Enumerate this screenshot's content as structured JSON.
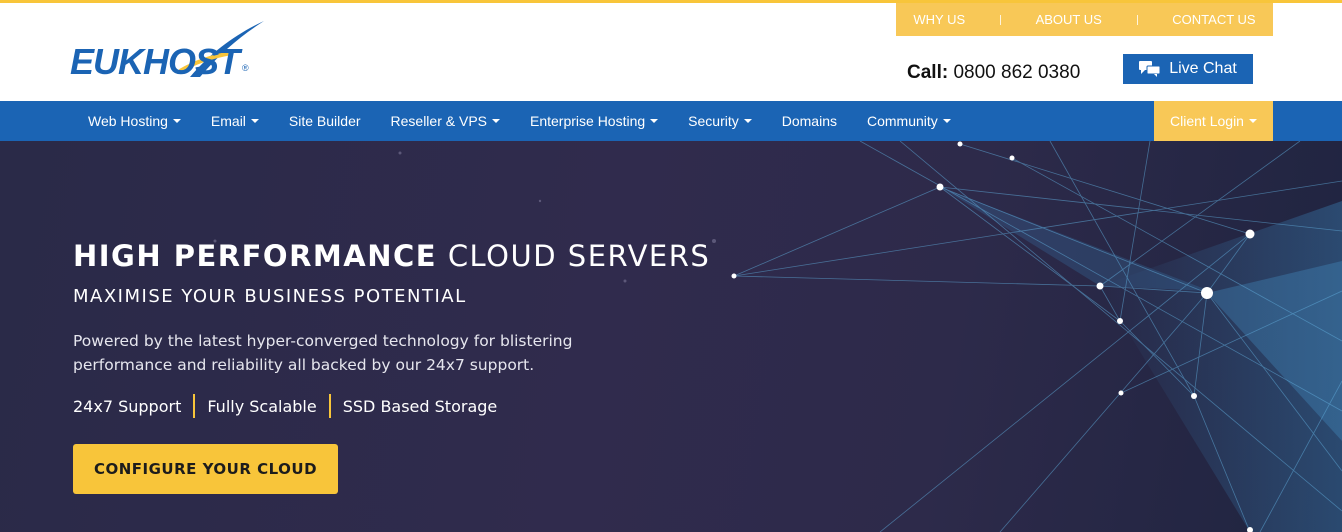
{
  "brand": {
    "logo_text": "EUKHOST",
    "logo_mark": "®",
    "primary_color": "#1b64b4",
    "accent_color": "#f8c53a"
  },
  "top_links": [
    {
      "label": "WHY US"
    },
    {
      "label": "ABOUT US"
    },
    {
      "label": "CONTACT US"
    }
  ],
  "contact": {
    "call_label": "Call:",
    "phone": "0800 862 0380"
  },
  "live_chat": {
    "label": "Live Chat",
    "icon": "chat-bubbles-icon"
  },
  "nav": {
    "items": [
      {
        "label": "Web Hosting",
        "dropdown": true
      },
      {
        "label": "Email",
        "dropdown": true
      },
      {
        "label": "Site Builder",
        "dropdown": false
      },
      {
        "label": "Reseller & VPS",
        "dropdown": true
      },
      {
        "label": "Enterprise Hosting",
        "dropdown": true
      },
      {
        "label": "Security",
        "dropdown": true
      },
      {
        "label": "Domains",
        "dropdown": false
      },
      {
        "label": "Community",
        "dropdown": true
      }
    ],
    "client_login": "Client Login"
  },
  "hero": {
    "title_bold": "HIGH PERFORMANCE",
    "title_light": "CLOUD SERVERS",
    "subtitle": "MAXIMISE YOUR BUSINESS POTENTIAL",
    "description": "Powered by the latest hyper-converged technology for blistering performance and reliability all backed by our 24x7 support.",
    "features": [
      "24x7 Support",
      "Fully Scalable",
      "SSD Based Storage"
    ],
    "cta_label": "CONFIGURE YOUR CLOUD"
  }
}
